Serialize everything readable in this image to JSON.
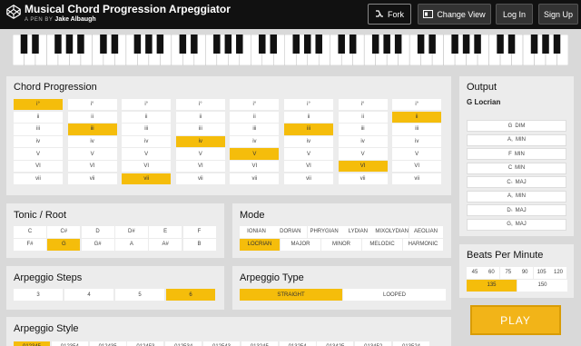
{
  "header": {
    "title": "Musical Chord Progression Arpeggiator",
    "byline_prefix": "A PEN BY",
    "author": "Jake Albaugh",
    "buttons": {
      "fork": "Fork",
      "change_view": "Change View",
      "log_in": "Log In",
      "sign_up": "Sign Up"
    }
  },
  "chord_progression": {
    "title": "Chord Progression",
    "numerals": [
      "i°",
      "ii",
      "iii",
      "iv",
      "V",
      "VI",
      "vii"
    ],
    "selected": [
      0,
      2,
      6,
      3,
      4,
      2,
      5,
      1
    ]
  },
  "tonic": {
    "title": "Tonic / Root",
    "notes": [
      "C",
      "C#",
      "D",
      "D#",
      "E",
      "F",
      "F#",
      "G",
      "G#",
      "A",
      "A#",
      "B"
    ],
    "selected": 7
  },
  "mode": {
    "title": "Mode",
    "options": [
      "IONIAN",
      "DORIAN",
      "PHRYGIAN",
      "LYDIAN",
      "MIXOLYDIAN",
      "AEOLIAN",
      "LOCRIAN",
      "MAJOR",
      "MINOR",
      "MELODIC",
      "HARMONIC"
    ],
    "selected": 6
  },
  "arpeggio_steps": {
    "title": "Arpeggio Steps",
    "options": [
      "3",
      "4",
      "5",
      "6"
    ],
    "selected": 3
  },
  "arpeggio_type": {
    "title": "Arpeggio Type",
    "options": [
      "STRAIGHT",
      "LOOPED"
    ],
    "selected": 0
  },
  "arpeggio_style": {
    "title": "Arpeggio Style",
    "options": [
      "012345",
      "012354",
      "012435",
      "012453",
      "012534",
      "012543",
      "013245",
      "013254",
      "013425",
      "013452",
      "013524"
    ],
    "selected": 0
  },
  "output": {
    "title": "Output",
    "key": "G Locrian",
    "chords": [
      {
        "root": "G",
        "acc": "",
        "quality": "DIM"
      },
      {
        "root": "A",
        "acc": "♭",
        "quality": "MIN"
      },
      {
        "root": "F",
        "acc": "",
        "quality": "MIN"
      },
      {
        "root": "C",
        "acc": "",
        "quality": "MIN"
      },
      {
        "root": "C",
        "acc": "♭",
        "quality": "MAJ"
      },
      {
        "root": "A",
        "acc": "♭",
        "quality": "MIN"
      },
      {
        "root": "D",
        "acc": "♭",
        "quality": "MAJ"
      },
      {
        "root": "G",
        "acc": "♭",
        "quality": "MAJ"
      }
    ]
  },
  "bpm": {
    "title": "Beats Per Minute",
    "options": [
      "45",
      "60",
      "75",
      "90",
      "105",
      "120",
      "135",
      "150"
    ],
    "selected": 6
  },
  "play_label": "PLAY",
  "colors": {
    "accent": "#f5bd0b",
    "header_bg": "#111111",
    "page_bg": "#d9d9d9",
    "card_bg": "#ececec"
  },
  "icons": {
    "logo": "codepen-logo-icon",
    "fork": "fork-icon",
    "change_view": "layout-icon"
  }
}
